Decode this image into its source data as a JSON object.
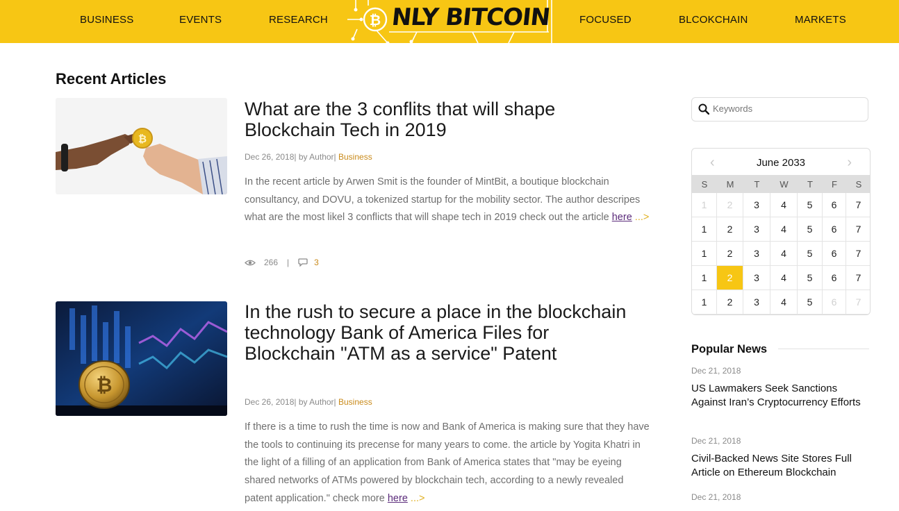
{
  "nav": {
    "left": [
      "BUSINESS",
      "EVENTS",
      "RESEARCH"
    ],
    "right": [
      "FOCUSED",
      "BLCOKCHAIN",
      "MARKETS"
    ],
    "logo_text": "NLY BITCOIN",
    "brand_color": "#f7c614"
  },
  "main": {
    "section_title": "Recent Articles",
    "articles": [
      {
        "title": "What are the 3 conflits that will shape Blockchain Tech in 2019",
        "meta_prefix": "Dec 26, 2018| by Author|",
        "category": "Business",
        "excerpt": "In the recent article by Arwen Smit is the founder of MintBit, a boutique blockchain consultancy, and DOVU, a tokenized startup for the mobility sector. The author descripes what are the most likel 3 conflicts that will shape tech in 2019 check out the article",
        "link_text": "here",
        "more": "...>",
        "views": "266",
        "separator": "|",
        "comments": "3",
        "thumb_icon": "hands-exchanging-bitcoin-image"
      },
      {
        "title": "In the rush to secure a place in the blockchain technology Bank of America Files for Blockchain \"ATM as a service\" Patent",
        "meta_prefix": "Dec 26, 2018| by Author|",
        "category": "Business",
        "excerpt": "If there is a time to rush the time is now and Bank of America is making sure that they have the tools to continuing its precense for many years to come. the article by Yogita Khatri in the light of a filling of an application from Bank of America states that \"may be eyeing shared networks of ATMs powered by blockchain tech, according to a newly revealed patent application.\" check more",
        "link_text": "here",
        "more": "...>",
        "thumb_icon": "bitcoin-coin-chart-image"
      }
    ]
  },
  "sidebar": {
    "search_placeholder": "Keywords",
    "calendar": {
      "month": "June 2033",
      "prev": "‹",
      "next": "›",
      "days_of_week": [
        "S",
        "M",
        "T",
        "W",
        "T",
        "F",
        "S"
      ],
      "weeks": [
        [
          {
            "d": "1",
            "faded": true
          },
          {
            "d": "2",
            "faded": true
          },
          {
            "d": "3"
          },
          {
            "d": "4"
          },
          {
            "d": "5"
          },
          {
            "d": "6"
          },
          {
            "d": "7"
          }
        ],
        [
          {
            "d": "1"
          },
          {
            "d": "2"
          },
          {
            "d": "3"
          },
          {
            "d": "4"
          },
          {
            "d": "5"
          },
          {
            "d": "6"
          },
          {
            "d": "7"
          }
        ],
        [
          {
            "d": "1"
          },
          {
            "d": "2"
          },
          {
            "d": "3"
          },
          {
            "d": "4"
          },
          {
            "d": "5"
          },
          {
            "d": "6"
          },
          {
            "d": "7"
          }
        ],
        [
          {
            "d": "1"
          },
          {
            "d": "2",
            "today": true
          },
          {
            "d": "3"
          },
          {
            "d": "4"
          },
          {
            "d": "5"
          },
          {
            "d": "6"
          },
          {
            "d": "7"
          }
        ],
        [
          {
            "d": "1"
          },
          {
            "d": "2"
          },
          {
            "d": "3"
          },
          {
            "d": "4"
          },
          {
            "d": "5"
          },
          {
            "d": "6",
            "faded": true
          },
          {
            "d": "7",
            "faded": true
          }
        ]
      ]
    },
    "popular": {
      "title": "Popular News",
      "items": [
        {
          "date": "Dec 21, 2018",
          "title": "US Lawmakers Seek Sanctions Against Iran’s Cryptocurrency Efforts"
        },
        {
          "date": "Dec 21, 2018",
          "title": "Civil-Backed News Site Stores Full Article on Ethereum Blockchain"
        },
        {
          "date": "Dec 21, 2018",
          "title": ""
        }
      ]
    }
  }
}
